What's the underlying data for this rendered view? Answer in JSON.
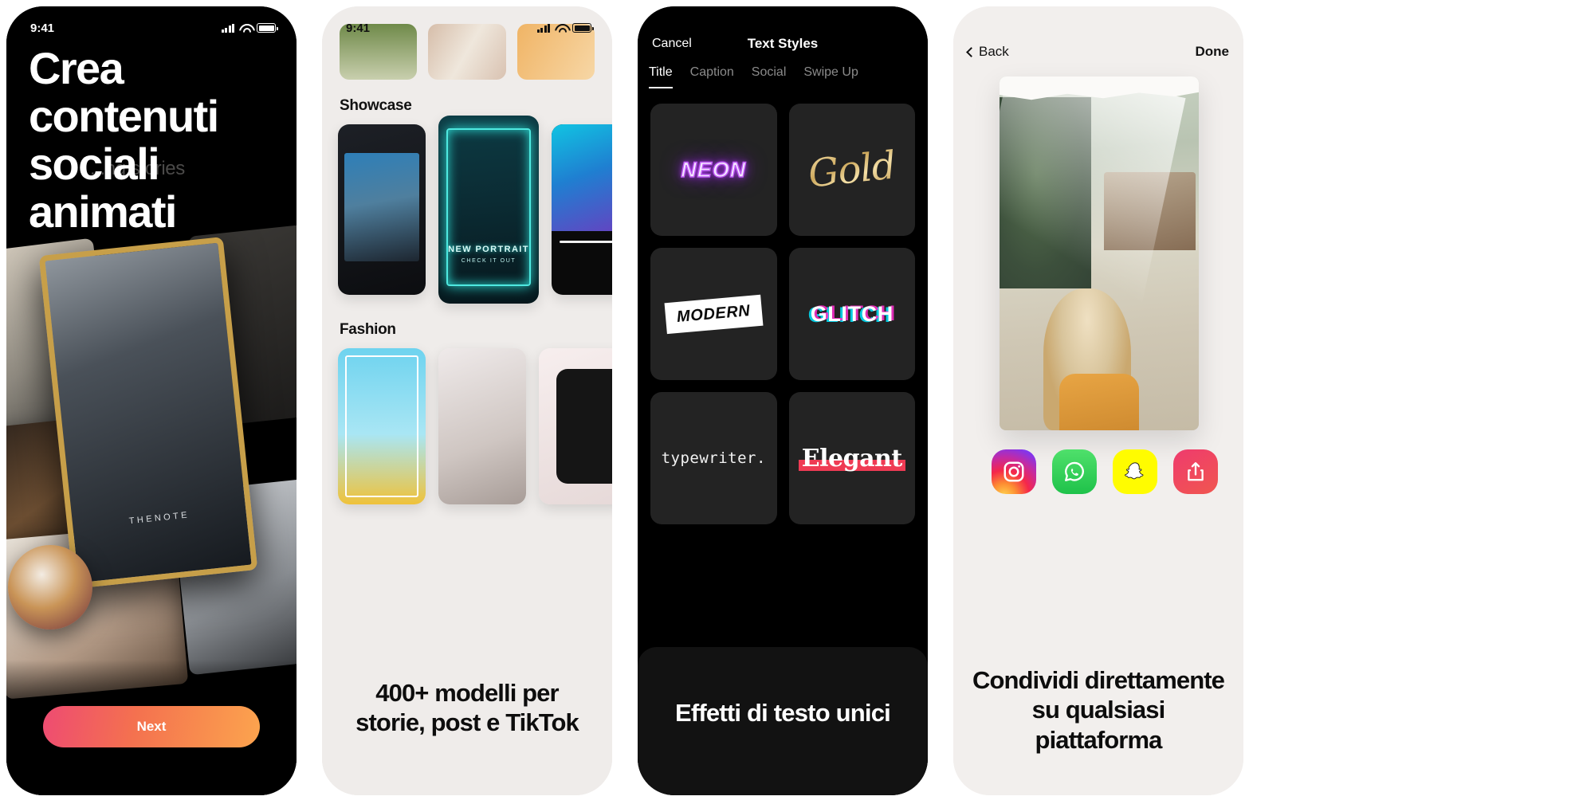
{
  "screens": [
    {
      "id": "onboarding-create",
      "theme": "dark",
      "status": {
        "time": "9:41"
      },
      "headline": "Crea contenuti sociali animati",
      "ghost_text": "...ng stories",
      "primary_button": "Next",
      "note_card_label": "THENOTE",
      "button_gradient_from": "#ee4b72",
      "button_gradient_to": "#fca44e"
    },
    {
      "id": "templates-browser",
      "theme": "light",
      "status": {
        "time": "9:41"
      },
      "sections": [
        {
          "title": "Showcase",
          "cards": [
            {
              "label": ""
            },
            {
              "label": "NEW PORTRAIT",
              "sublabel": "CHECK IT OUT"
            },
            {
              "label": ""
            }
          ]
        },
        {
          "title": "Fashion",
          "cards": [
            {
              "label": ""
            },
            {
              "label": ""
            },
            {
              "label": ""
            }
          ]
        }
      ],
      "caption": "400+ modelli per storie, post e TikTok"
    },
    {
      "id": "text-styles",
      "theme": "dark",
      "nav": {
        "cancel": "Cancel",
        "title": "Text Styles"
      },
      "tabs": [
        {
          "label": "Title",
          "active": true
        },
        {
          "label": "Caption",
          "active": false
        },
        {
          "label": "Social",
          "active": false
        },
        {
          "label": "Swipe Up",
          "active": false
        }
      ],
      "styles": [
        {
          "name": "NEON",
          "kind": "neon",
          "color": "#c05cf5"
        },
        {
          "name": "Gold",
          "kind": "gold",
          "color": "#cda85c"
        },
        {
          "name": "MODERN",
          "kind": "modern",
          "color": "#ffffff"
        },
        {
          "name": "GLITCH",
          "kind": "glitch",
          "color": "#00e5ff"
        },
        {
          "name": "typewriter.",
          "kind": "mono",
          "color": "#f2f2f2"
        },
        {
          "name": "Elegant",
          "kind": "serif",
          "color": "#ef3b54"
        }
      ],
      "caption": "Effetti di testo unici"
    },
    {
      "id": "share-sheet",
      "theme": "light",
      "nav": {
        "back": "Back",
        "done": "Done"
      },
      "socials": [
        {
          "name": "instagram",
          "color": "#c32aa3"
        },
        {
          "name": "whatsapp",
          "color": "#1fc24a"
        },
        {
          "name": "snapchat",
          "color": "#fffc00"
        },
        {
          "name": "share",
          "color": "#ef3b6e"
        }
      ],
      "caption": "Condividi direttamente su qualsiasi piattaforma"
    }
  ]
}
